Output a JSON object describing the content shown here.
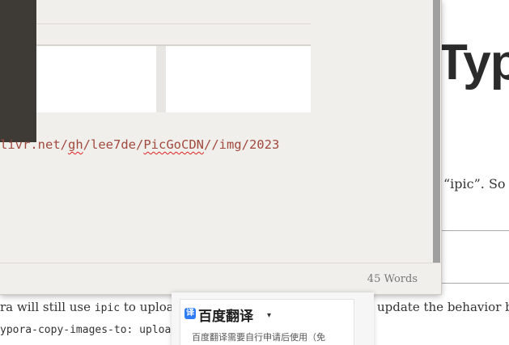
{
  "background_doc": {
    "title_fragment": "Typo",
    "ipic_text": "“ipic”. So",
    "line1_left_a": "ra will still use ",
    "line1_code": "ipic",
    "line1_left_b": " to uploa",
    "line1_right": " update the behavior b",
    "line2_code": "ypora-copy-images-to: uploa"
  },
  "editor": {
    "code_url": {
      "part1": "livr.net/",
      "part2": "gh",
      "part3": "/lee7de/",
      "part4": "PicGoCDN",
      "part5": "//img/2023"
    },
    "word_count": "45 Words"
  },
  "translate_popup": {
    "logo_glyph": "译",
    "title": "百度翻译",
    "caret": "▾",
    "note": "百度翻译需要自行申请后使用（免"
  }
}
